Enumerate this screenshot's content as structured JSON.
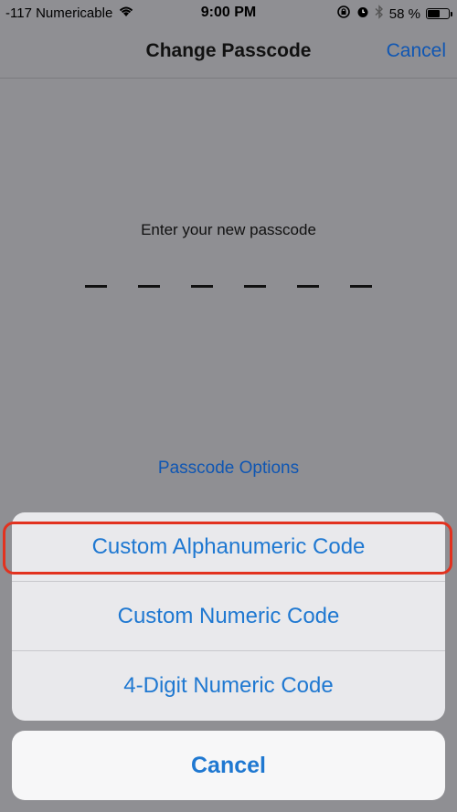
{
  "status_bar": {
    "signal": "-117",
    "carrier": "Numericable",
    "time": "9:00 PM",
    "battery_percent": "58 %",
    "battery_level": 0.58
  },
  "nav": {
    "title": "Change Passcode",
    "cancel_label": "Cancel"
  },
  "passcode": {
    "prompt": "Enter your new passcode",
    "digit_count": 6,
    "options_label": "Passcode Options"
  },
  "action_sheet": {
    "options": [
      {
        "label": "Custom Alphanumeric Code",
        "highlighted": true
      },
      {
        "label": "Custom Numeric Code",
        "highlighted": false
      },
      {
        "label": "4-Digit Numeric Code",
        "highlighted": false
      }
    ],
    "cancel_label": "Cancel"
  },
  "colors": {
    "accent": "#1f78d1",
    "highlight": "#e2321f"
  },
  "icons": [
    "wifi-icon",
    "rotation-lock-icon",
    "alarm-icon",
    "bluetooth-icon",
    "battery-icon"
  ]
}
